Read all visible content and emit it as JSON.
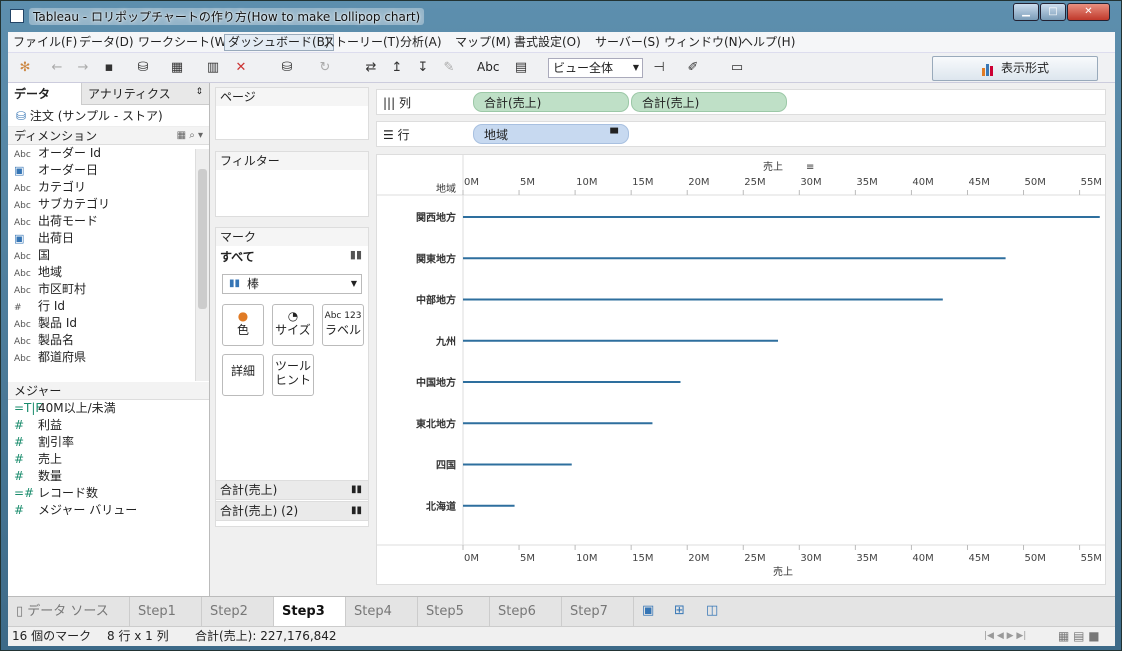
{
  "window": {
    "title": "Tableau - ロリポップチャートの作り方(How to make Lollipop chart)"
  },
  "menu": [
    "ファイル(F)",
    "データ(D)",
    "ワークシート(W)",
    "ダッシュボード(B)",
    "ストーリー(T)",
    "分析(A)",
    "マップ(M)",
    "書式設定(O)",
    "サーバー(S)",
    "ウィンドウ(N)",
    "ヘルプ(H)"
  ],
  "toolbar": {
    "abc_label": "Abc",
    "fit_select": "ビュー全体",
    "show_me": "表示形式"
  },
  "data_panel": {
    "tab_data": "データ",
    "tab_analytics": "アナリティクス",
    "datasource": "注文 (サンプル - ストア)",
    "dimensions_header": "ディメンション",
    "dimensions": [
      {
        "type": "Abc",
        "name": "オーダー Id"
      },
      {
        "type": "date",
        "name": "オーダー日"
      },
      {
        "type": "Abc",
        "name": "カテゴリ"
      },
      {
        "type": "Abc",
        "name": "サブカテゴリ"
      },
      {
        "type": "Abc",
        "name": "出荷モード"
      },
      {
        "type": "date",
        "name": "出荷日"
      },
      {
        "type": "Abc",
        "name": "国"
      },
      {
        "type": "Abc",
        "name": "地域"
      },
      {
        "type": "Abc",
        "name": "市区町村"
      },
      {
        "type": "#",
        "name": "行 Id"
      },
      {
        "type": "Abc",
        "name": "製品 Id"
      },
      {
        "type": "Abc",
        "name": "製品名"
      },
      {
        "type": "Abc",
        "name": "都道府県"
      }
    ],
    "measures_header": "メジャー",
    "measures": [
      {
        "type": "=T|F",
        "name": "40M以上/未満"
      },
      {
        "type": "#",
        "name": "利益"
      },
      {
        "type": "#",
        "name": "割引率"
      },
      {
        "type": "#",
        "name": "売上"
      },
      {
        "type": "#",
        "name": "数量"
      },
      {
        "type": "=#",
        "name": "レコード数"
      },
      {
        "type": "#",
        "name": "メジャー バリュー"
      }
    ]
  },
  "cards": {
    "pages": "ページ",
    "filters": "フィルター",
    "marks": "マーク",
    "marks_all": "すべて",
    "mark_type": "棒",
    "color": "色",
    "size": "サイズ",
    "label": "ラベル",
    "label_icon": "Abc 123",
    "detail": "詳細",
    "tooltip_line1": "ツール",
    "tooltip_line2": "ヒント",
    "measure1": "合計(売上)",
    "measure2": "合計(売上) (2)"
  },
  "shelves": {
    "columns_label": "列",
    "rows_label": "行",
    "columns_pills": [
      "合計(売上)",
      "合計(売上)"
    ],
    "rows_pill": "地域"
  },
  "chart_data": {
    "type": "bar",
    "orientation": "horizontal",
    "row_header": "地域",
    "xlabel": "売上",
    "xlim": [
      0,
      57000000
    ],
    "x_ticks": [
      "0M",
      "5M",
      "10M",
      "15M",
      "20M",
      "25M",
      "30M",
      "35M",
      "40M",
      "45M",
      "50M",
      "55M"
    ],
    "categories": [
      "関西地方",
      "関東地方",
      "中部地方",
      "九州",
      "中国地方",
      "東北地方",
      "四国",
      "北海道"
    ],
    "values": [
      56800000,
      48400000,
      42800000,
      28100000,
      19400000,
      16900000,
      9700000,
      4600000
    ],
    "bar_color": "#2e6f9e"
  },
  "sheet_tabs": {
    "datasource": "データ ソース",
    "sheets": [
      "Step1",
      "Step2",
      "Step3",
      "Step4",
      "Step5",
      "Step6",
      "Step7"
    ],
    "active": "Step3"
  },
  "status": {
    "marks": "16 個のマーク",
    "dims": "8 行 x 1 列",
    "sum": "合計(売上): 227,176,842"
  }
}
